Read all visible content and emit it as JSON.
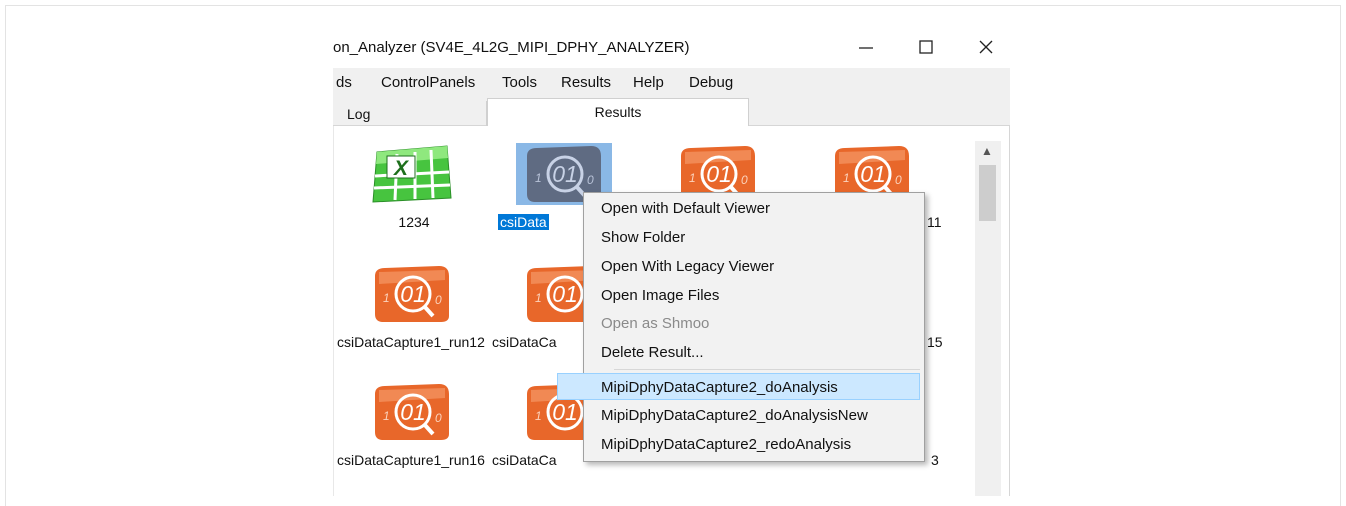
{
  "window": {
    "title": "on_Analyzer (SV4E_4L2G_MIPI_DPHY_ANALYZER)",
    "minimize_glyph": "—",
    "maximize_glyph": "☐",
    "close_glyph": "✕"
  },
  "menu": {
    "items": [
      "ds",
      "ControlPanels",
      "Tools",
      "Results",
      "Help",
      "Debug"
    ]
  },
  "tabs": [
    {
      "label": "Log"
    },
    {
      "label": "Results",
      "active": true
    }
  ],
  "files": [
    {
      "label": "1234",
      "icon": "excel-file-icon"
    },
    {
      "label": "csiData",
      "icon": "binary-data-file-icon",
      "selected": true
    },
    {
      "label": "",
      "icon": "binary-data-file-icon"
    },
    {
      "label": "11",
      "icon": "binary-data-file-icon"
    },
    {
      "label": "csiDataCapture1_run12",
      "icon": "binary-data-file-icon"
    },
    {
      "label": "csiDataCa",
      "icon": "binary-data-file-icon"
    },
    {
      "label": "15",
      "icon": "binary-data-file-icon"
    },
    {
      "label": "csiDataCapture1_run16",
      "icon": "binary-data-file-icon"
    },
    {
      "label": "csiDataCa",
      "icon": "binary-data-file-icon"
    },
    {
      "label": "3",
      "icon": "binary-data-file-icon"
    }
  ],
  "context_menu": {
    "items": [
      {
        "label": "Open with Default Viewer"
      },
      {
        "label": "Show Folder"
      },
      {
        "label": "Open With Legacy Viewer"
      },
      {
        "label": "Open Image Files"
      },
      {
        "label": "Open as Shmoo",
        "disabled": true
      },
      {
        "label": "Delete Result..."
      },
      {
        "label": "MipiDphyDataCapture2_doAnalysis",
        "highlighted": true
      },
      {
        "label": "MipiDphyDataCapture2_doAnalysisNew"
      },
      {
        "label": "MipiDphyDataCapture2_redoAnalysis"
      }
    ]
  },
  "colors": {
    "selection": "#0078d7",
    "highlight": "#cce8ff",
    "orange_icon": "#e8672a",
    "excel_green": "#3dbe3a"
  }
}
